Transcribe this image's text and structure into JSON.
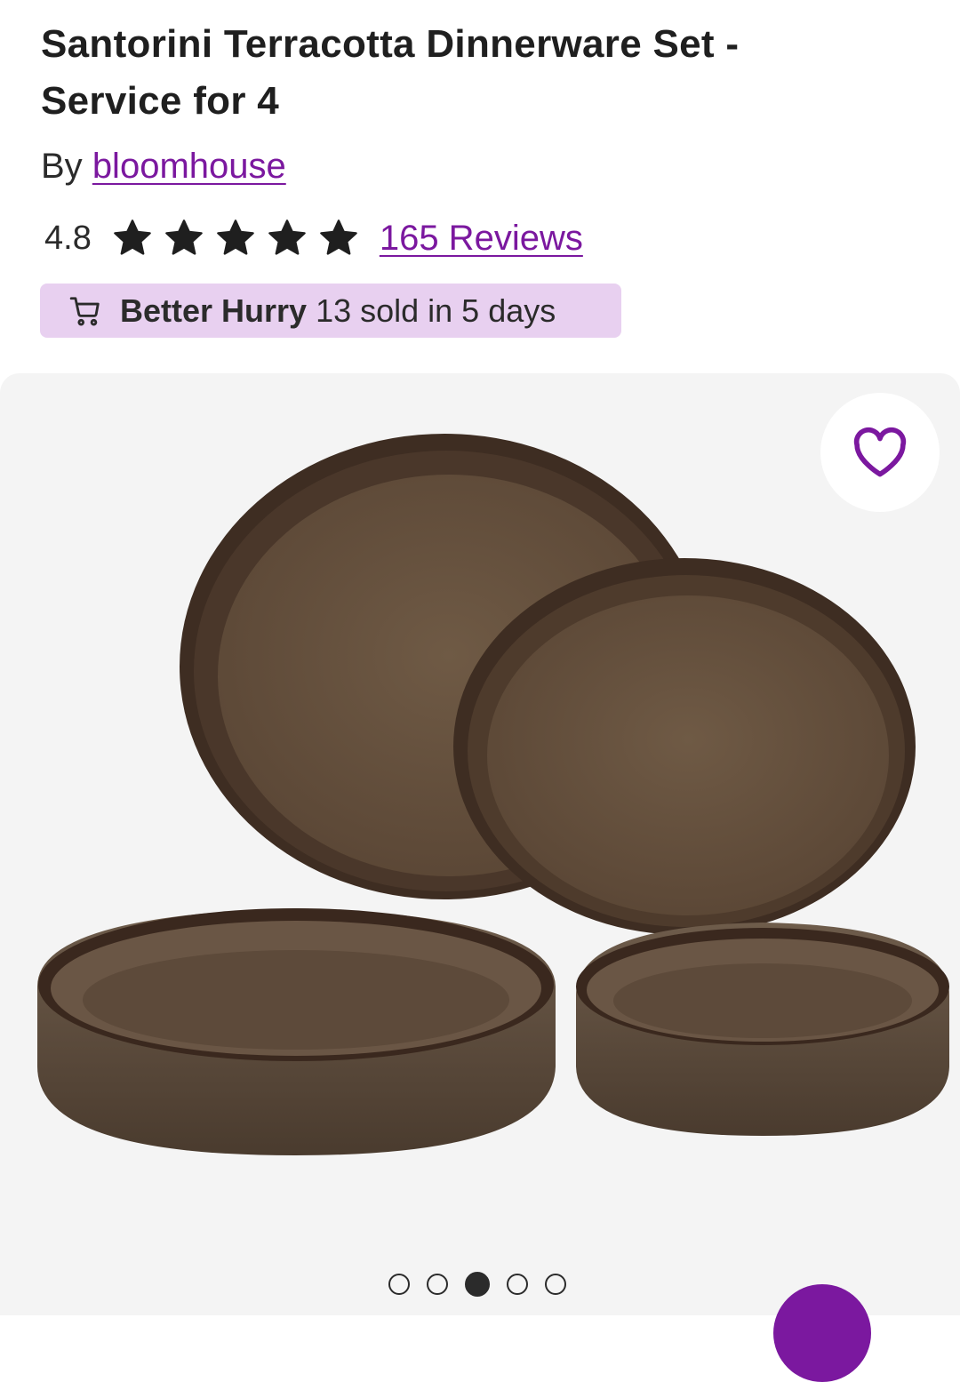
{
  "product": {
    "title": "Santorini Terracotta Dinnerware Set - Service for 4",
    "by_prefix": "By",
    "brand": "bloomhouse",
    "rating": "4.8",
    "rating_value": 4.8,
    "rating_max": 5,
    "reviews_link": "165 Reviews"
  },
  "urgency_badge": {
    "icon": "cart-icon",
    "strong": "Better Hurry",
    "text": "13 sold in 5 days"
  },
  "gallery": {
    "favorite_icon": "heart-icon",
    "image_count": 5,
    "active_index": 2
  },
  "colors": {
    "accent": "#7b189f",
    "badge_bg": "#e8d0f0",
    "gallery_bg": "#f4f4f4",
    "text": "#2b2b2b"
  }
}
